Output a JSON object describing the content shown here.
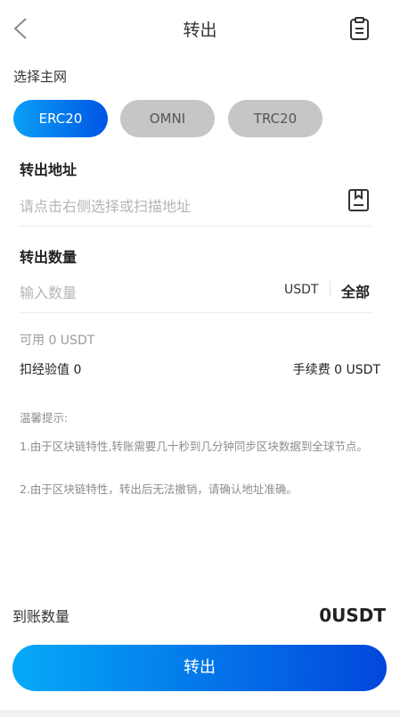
{
  "header": {
    "title": "转出"
  },
  "network": {
    "label": "选择主网",
    "options": [
      "ERC20",
      "OMNI",
      "TRC20"
    ],
    "selected": "ERC20"
  },
  "address": {
    "title": "转出地址",
    "placeholder": "请点击右侧选择或扫描地址"
  },
  "amount": {
    "title": "转出数量",
    "placeholder": "输入数量",
    "unit": "USDT",
    "all_label": "全部"
  },
  "balance": {
    "available": "可用 0 USDT",
    "deduct": "扣经验值 0",
    "fee": "手续费 0 USDT"
  },
  "tips": {
    "title": "温馨提示:",
    "line1": "1.由于区块链特性,转账需要几十秒到几分钟同步区块数据到全球节点。",
    "line2": "2.由于区块链特性，转出后无法撤销，请确认地址准确。"
  },
  "received": {
    "label": "到账数量",
    "value": "0USDT"
  },
  "submit_label": "转出"
}
